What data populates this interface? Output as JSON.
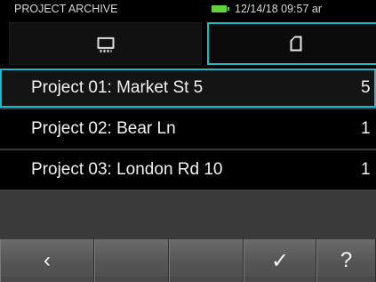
{
  "status": {
    "title": "PROJECT ARCHIVE",
    "datetime": "12/14/18 09:57 ar",
    "battery_color": "#5fd33a"
  },
  "tabs": [
    {
      "icon": "internal-memory-icon",
      "selected": false
    },
    {
      "icon": "sd-card-icon",
      "selected": true
    }
  ],
  "projects": [
    {
      "name": "Project 01: Market St 5",
      "count": "5",
      "selected": true
    },
    {
      "name": "Project 02: Bear Ln",
      "count": "1",
      "selected": false
    },
    {
      "name": "Project 03: London Rd 10",
      "count": "1",
      "selected": false
    }
  ],
  "buttons": {
    "back": "‹",
    "blank1": "",
    "blank2": "",
    "confirm": "✓",
    "help": "?"
  },
  "accent_color": "#1fb8c7"
}
